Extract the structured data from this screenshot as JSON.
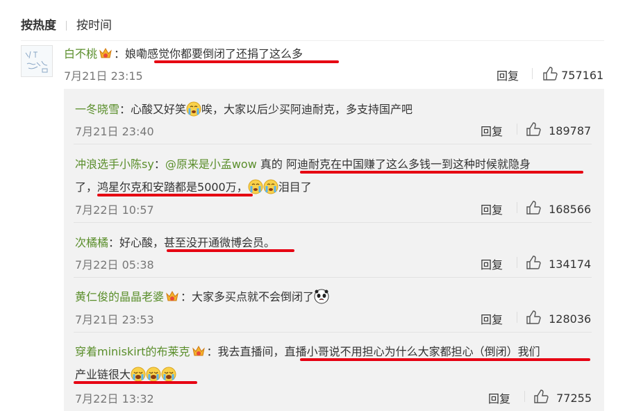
{
  "sort": {
    "hot": "按热度",
    "time": "按时间"
  },
  "main_comment": {
    "user": "白不桃",
    "sep": "：",
    "text": "娘嘞感觉你都要倒闭了还捐了这么多",
    "date": "7月21日 23:15",
    "reply": "回复",
    "likes": "757161"
  },
  "replies": [
    {
      "user": "一冬晓雪",
      "sep": "：",
      "text_a": "心酸又好笑",
      "text_b": "唉，大家以后少买阿迪耐克，多支持国产吧",
      "date": "7月21日 23:40",
      "reply": "回复",
      "likes": "189787"
    },
    {
      "user": "冲浪选手小陈sy",
      "sep": "：",
      "mention": "@原来是小孟wow",
      "text_a": " 真的 ",
      "text_b": "阿迪耐克在中国赚了这么多钱一到这种时候就隐身",
      "text_c": "了，",
      "text_d": "鸿星尔克和安踏都是5000万",
      "text_e": "，",
      "text_f": "泪目了",
      "date": "7月22日 10:57",
      "reply": "回复",
      "likes": "168566"
    },
    {
      "user": "次橘橘",
      "sep": "：",
      "text_a": "好心酸",
      "text_b": "，甚至没开通微博会员。",
      "date": "7月22日 05:38",
      "reply": "回复",
      "likes": "134174"
    },
    {
      "user": "黄仁俊的晶晶老婆",
      "sep": "：",
      "text_a": "大家多买点就不会倒闭了",
      "date": "7月21日 23:53",
      "reply": "回复",
      "likes": "128036"
    },
    {
      "user": "穿着miniskirt的布莱克",
      "sep": "：",
      "text_a": "我去直播间，",
      "text_b": "直播小哥说不用担心为什么大家都担心（倒闭）我们",
      "text_c": "产业链很大",
      "date": "7月22日 13:32",
      "reply": "回复",
      "likes": "77255"
    }
  ],
  "icons": {
    "like": "thumbs-up-icon",
    "badge": "gold-badge-icon",
    "cry": "crying-face-icon",
    "avatar": "handwriting-avatar"
  },
  "colors": {
    "name": "#5a8e2b",
    "underline": "#e60012",
    "reply_bg": "#f2f2f2"
  }
}
